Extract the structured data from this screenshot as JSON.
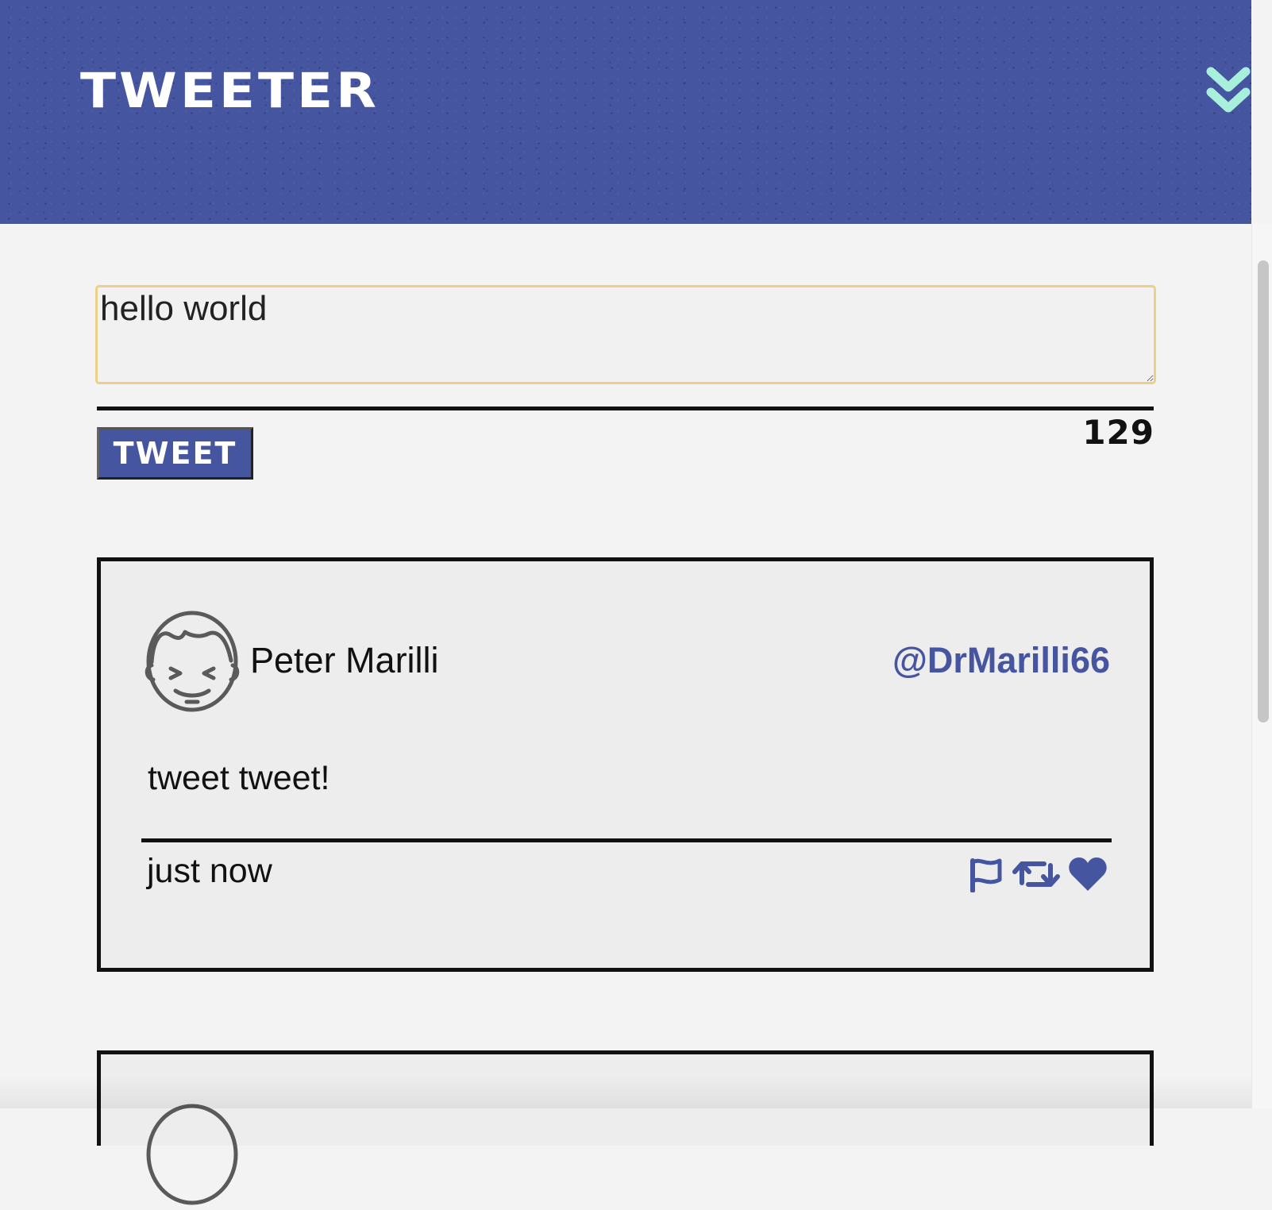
{
  "header": {
    "brand": "TWEETER",
    "compose_toggle_icon": "double-chevron-down-icon"
  },
  "compose": {
    "value": "hello world",
    "button_label": "TWEET",
    "char_count": "129"
  },
  "tweets": [
    {
      "avatar_icon": "face-avatar-icon",
      "name": "Peter Marilli",
      "handle": "@DrMarilli66",
      "content": "tweet tweet!",
      "timestamp": "just now",
      "actions": [
        "flag-icon",
        "retweet-icon",
        "heart-icon"
      ]
    },
    {
      "avatar_icon": "face-avatar-icon"
    }
  ],
  "colors": {
    "header_bg": "#4655a0",
    "accent": "#4655a0",
    "toggle": "#a8f0dc",
    "input_border": "#ecd087",
    "card_bg": "#ededee",
    "page_bg": "#f3f3f3"
  }
}
